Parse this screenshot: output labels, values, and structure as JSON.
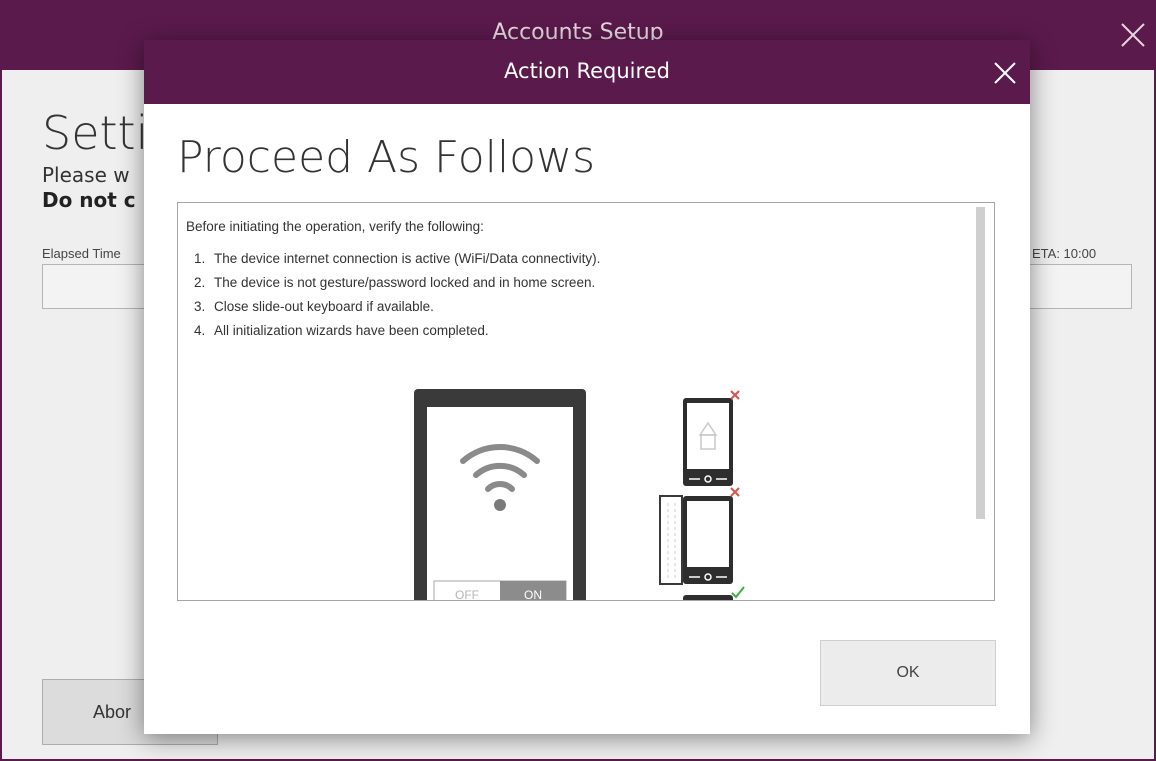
{
  "background_window": {
    "title": "Accounts Setup",
    "heading": "Setti",
    "message_line1": "Please w",
    "message_line2": "Do not c",
    "elapsed_label": "Elapsed Time",
    "eta_label": "ETA: 10:00",
    "abort_label": "Abor"
  },
  "dialog": {
    "title": "Action Required",
    "heading": "Proceed As Follows",
    "intro": "Before initiating the operation, verify the following:",
    "steps": [
      {
        "num": "1.",
        "text": "The device internet connection is active (WiFi/Data connectivity)."
      },
      {
        "num": "2.",
        "text": "The device is not gesture/password locked and in home screen."
      },
      {
        "num": "3.",
        "text": "Close slide-out keyboard if available."
      },
      {
        "num": "4.",
        "text": "All initialization wizards have been completed."
      }
    ],
    "toggle_off_label": "OFF",
    "toggle_on_label": "ON",
    "ok_label": "OK"
  },
  "colors": {
    "titlebar": "#5b1a4c",
    "error_mark": "#d9534f",
    "success_mark": "#3cb043"
  },
  "icons": [
    "close-icon",
    "wifi-icon",
    "phone-lock-icon",
    "phone-keyboard-icon",
    "check-icon",
    "cross-icon"
  ]
}
